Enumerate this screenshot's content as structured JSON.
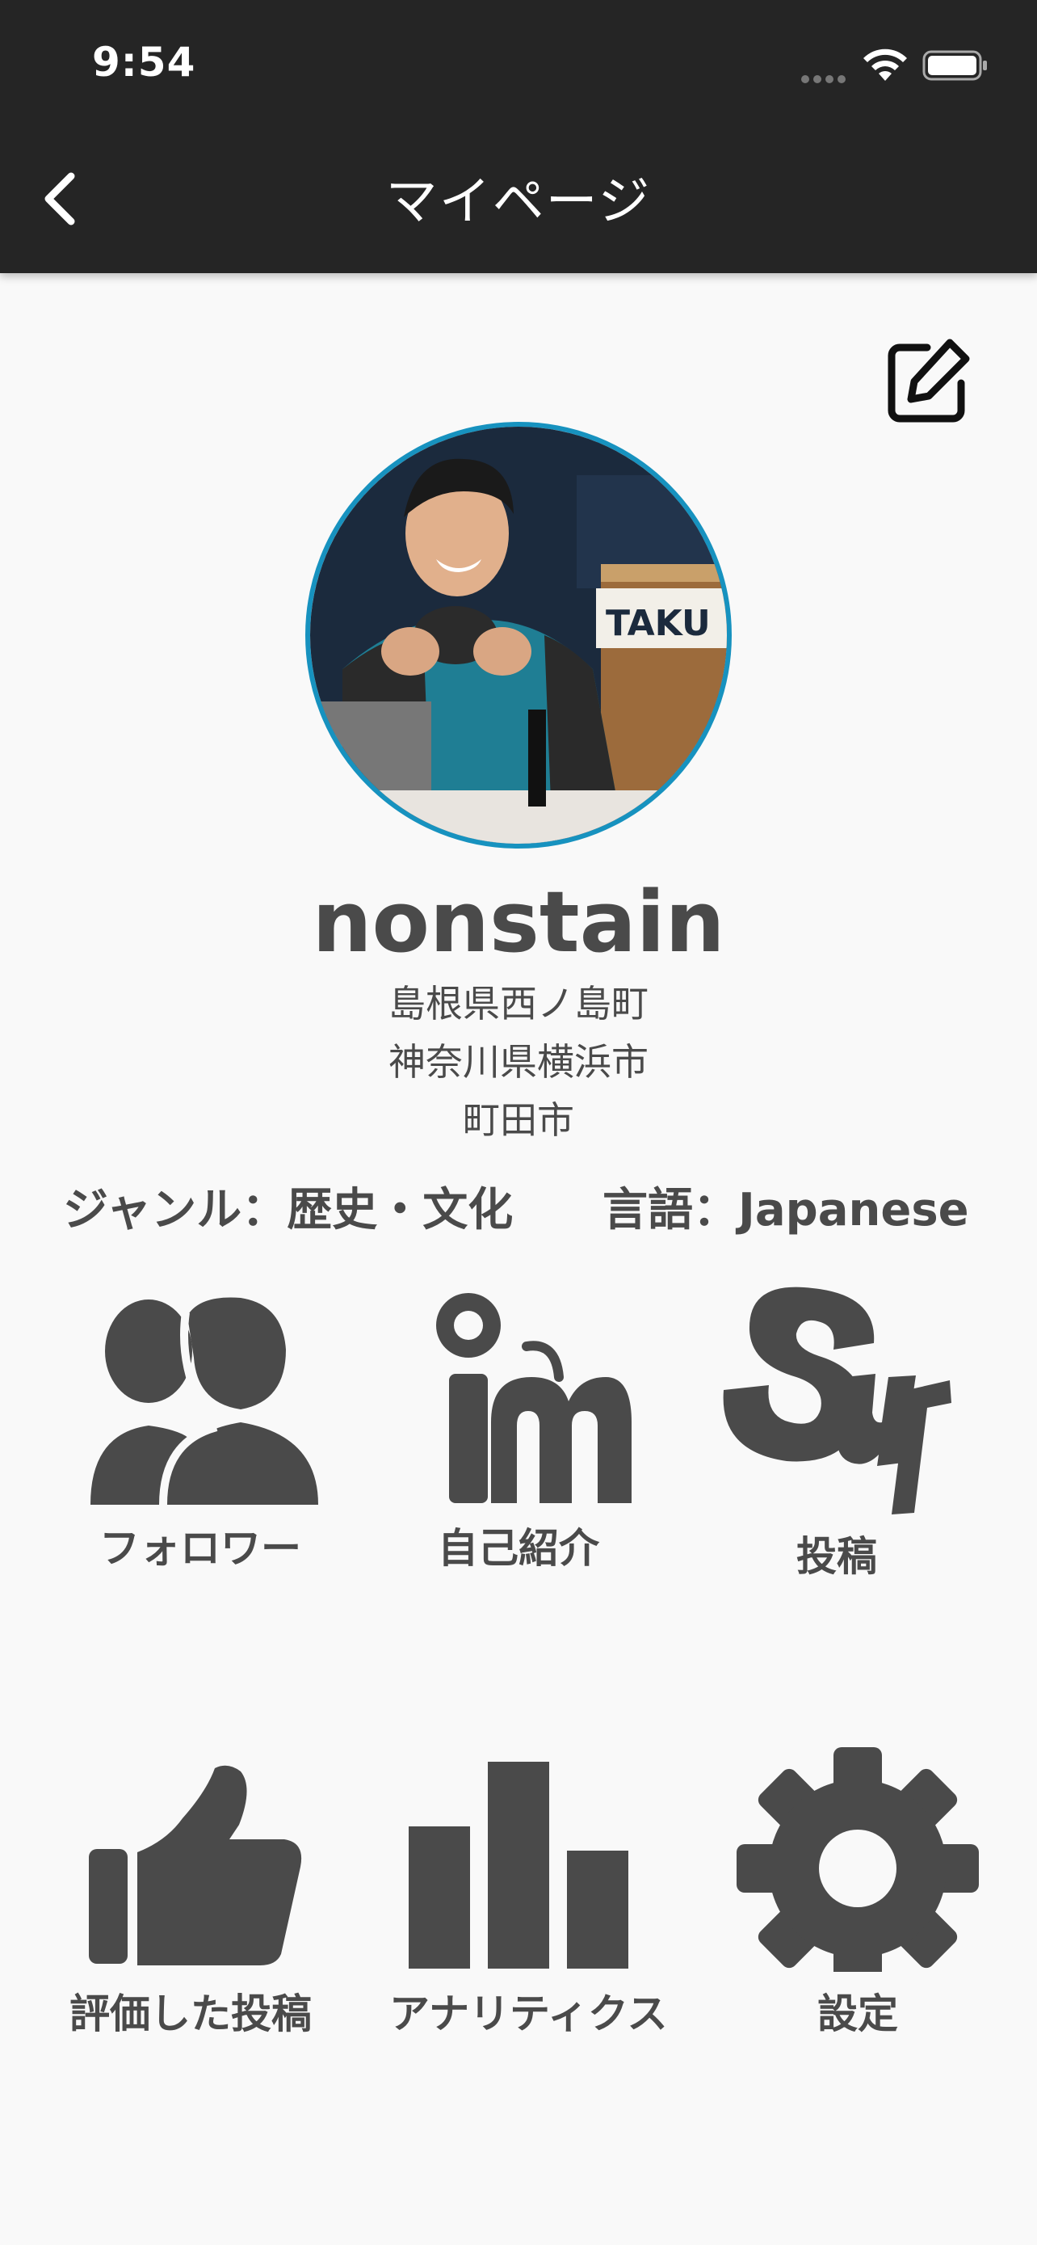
{
  "status_bar": {
    "time": "9:54"
  },
  "header": {
    "title": "マイページ"
  },
  "profile": {
    "username": "nonstain",
    "locations": [
      "島根県西ノ島町",
      "神奈川県横浜市",
      "町田市"
    ],
    "genre": "ジャンル：歴史・文化",
    "language": "言語：Japanese",
    "avatar_sign_text": "TAKU"
  },
  "menu": {
    "followers": "フォロワー",
    "self_intro": "自己紹介",
    "posts": "投稿",
    "liked_posts": "評価した投稿",
    "analytics": "アナリティクス",
    "settings": "設定"
  },
  "colors": {
    "header_bg": "#252525",
    "accent": "#1792bf",
    "icon": "#4a4a4a",
    "background": "#f9f9f9"
  }
}
